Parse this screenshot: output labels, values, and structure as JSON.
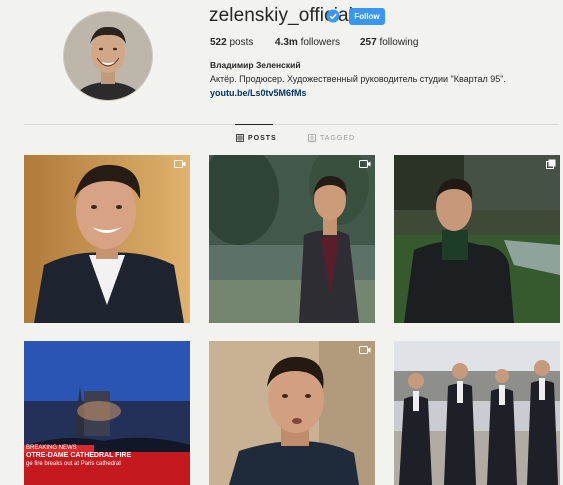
{
  "profile": {
    "username": "zelenskiy_official",
    "follow_label": "Follow",
    "posts_count": "522",
    "posts_label": "posts",
    "followers_count": "4.3m",
    "followers_label": "followers",
    "following_count": "257",
    "following_label": "following",
    "full_name": "Владимир Зеленский",
    "bio": "Актёр. Продюсер. Художественный руководитель студии \"Квартал 95\".",
    "link": "youtu.be/Ls0tv5M6fMs"
  },
  "tabs": [
    {
      "label": "POSTS",
      "icon": "grid-icon",
      "active": true
    },
    {
      "label": "TAGGED",
      "icon": "tag-icon",
      "active": false
    }
  ],
  "posts": [
    {
      "badge": "video-icon"
    },
    {
      "badge": "video-icon"
    },
    {
      "badge": "multi-photo-icon"
    },
    {
      "caption_lines": [
        "BREAKING NEWS",
        "OTRE-DAME CATHEDRAL FIRE",
        "ge fire breaks out at Paris cathedral"
      ]
    },
    {
      "badge": "video-icon"
    },
    {}
  ],
  "colors": {
    "accent": "#3897f0",
    "link": "#003569",
    "background": "#f2f2ee"
  }
}
